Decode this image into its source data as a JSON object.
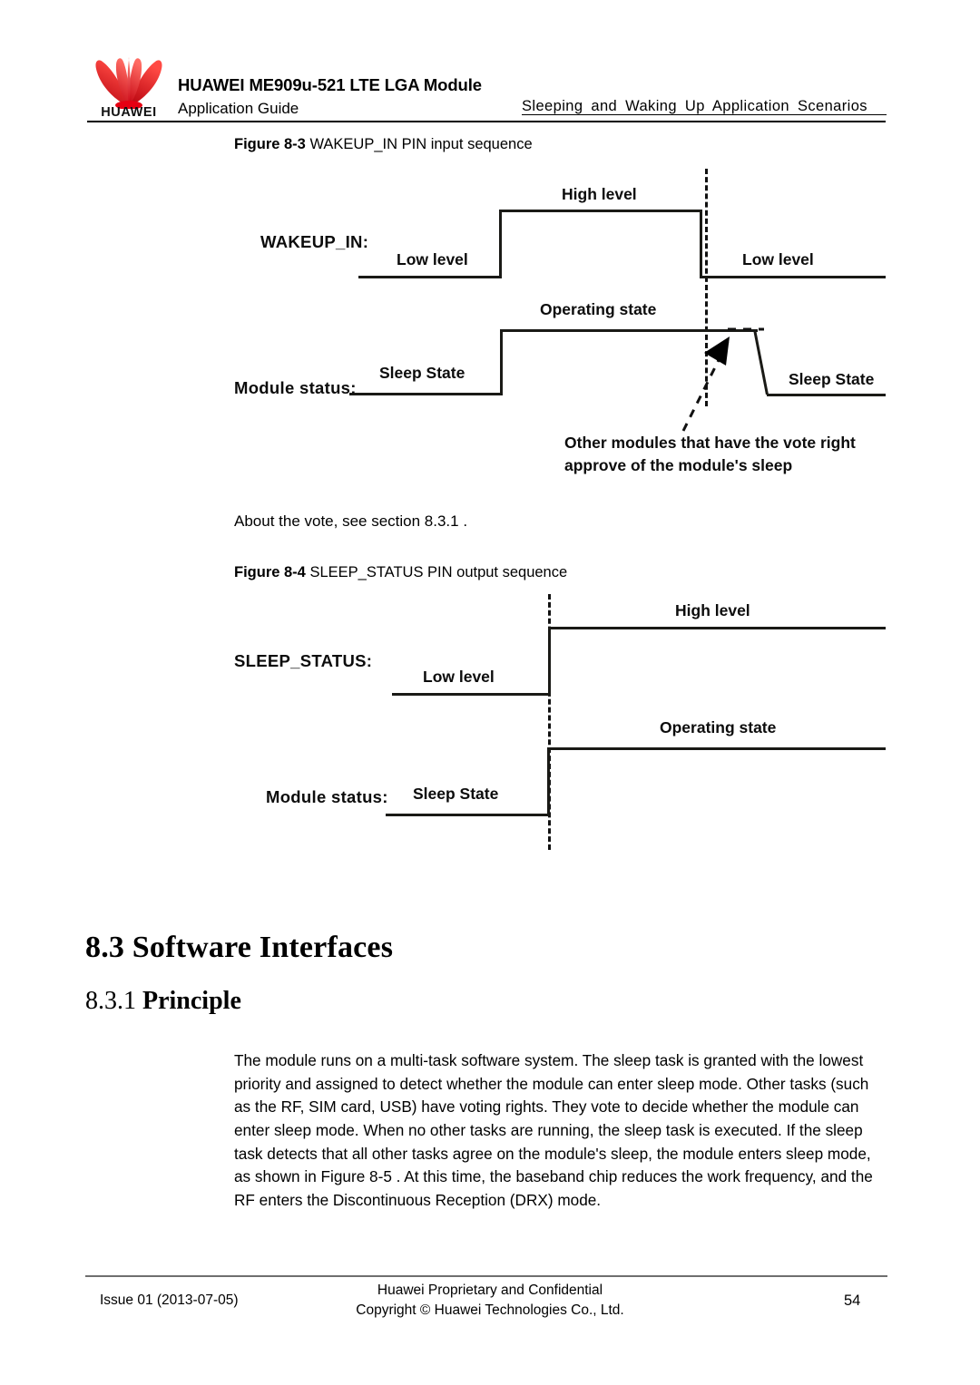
{
  "header": {
    "logo_word": "HUAWEI",
    "logo_color": "#e60012",
    "title_line1": "HUAWEI ME909u-521 LTE LGA Module",
    "title_line2": "Application Guide",
    "running_head": "Sleeping  and  Waking  Up  Application  Scenarios"
  },
  "figure_83": {
    "caption_number": "Figure 8-3",
    "caption_text": "WAKEUP_IN PIN input sequence",
    "signal_label": "WAKEUP_IN:",
    "status_label": "Module status:",
    "signal_low_left": "Low level",
    "signal_high": "High level",
    "signal_low_right": "Low level",
    "status_sleep_left": "Sleep State",
    "status_operating": "Operating state",
    "status_sleep_right": "Sleep State",
    "annotation_line1": "Other modules that have the vote right",
    "annotation_line2": "approve of the module's sleep"
  },
  "about_vote": "About the vote, see section 8.3.1 .",
  "figure_84": {
    "caption_number": "Figure 8-4",
    "caption_text": "SLEEP_STATUS PIN output sequence",
    "signal_label": "SLEEP_STATUS:",
    "status_label": "Module status:",
    "signal_low": "Low level",
    "signal_high": "High level",
    "status_sleep": "Sleep State",
    "status_operating": "Operating state"
  },
  "headings": {
    "h2": "8.3 Software Interfaces",
    "h3_number": "8.3.1 ",
    "h3_text": "Principle"
  },
  "body": {
    "paragraph": "The module runs on a multi-task software system. The sleep task is granted with the lowest priority and assigned to detect whether the module can enter sleep mode. Other tasks (such as the RF, SIM card, USB) have voting rights. They vote to decide whether the module can enter sleep mode. When no other tasks are running, the sleep task is executed. If the sleep task detects that all other tasks agree on the module's sleep, the module enters sleep mode, as shown in Figure 8-5 . At this time, the baseband chip reduces the work frequency, and the RF enters the Discontinuous Reception (DRX) mode."
  },
  "footer": {
    "issue": "Issue 01 (2013-07-05)",
    "confidential_line1": "Huawei Proprietary and Confidential",
    "confidential_line2": "Copyright © Huawei Technologies Co., Ltd.",
    "page_number": "54"
  }
}
